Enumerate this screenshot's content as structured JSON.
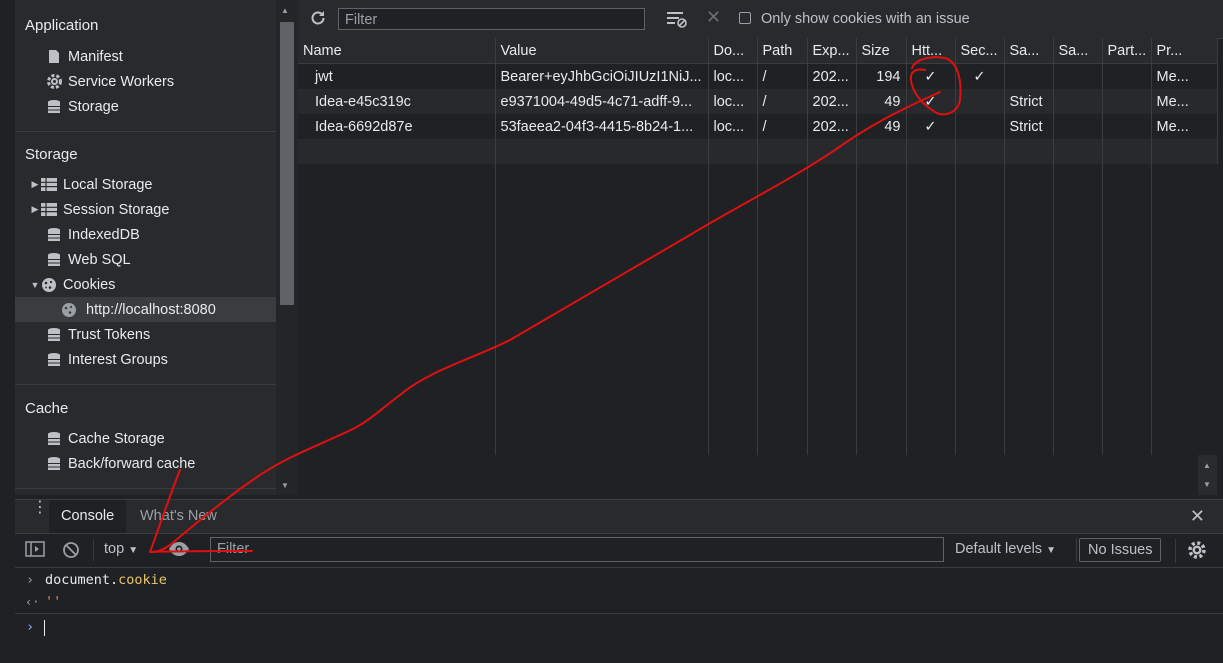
{
  "sidebar": {
    "application_title": "Application",
    "application_items": [
      "Manifest",
      "Service Workers",
      "Storage"
    ],
    "storage_title": "Storage",
    "storage_items": {
      "local_storage": "Local Storage",
      "session_storage": "Session Storage",
      "indexeddb": "IndexedDB",
      "web_sql": "Web SQL",
      "cookies": "Cookies",
      "cookies_origin": "http://localhost:8080",
      "trust_tokens": "Trust Tokens",
      "interest_groups": "Interest Groups"
    },
    "cache_title": "Cache",
    "cache_items": [
      "Cache Storage",
      "Back/forward cache"
    ]
  },
  "cookies_toolbar": {
    "filter_placeholder": "Filter",
    "only_issue_label": "Only show cookies with an issue",
    "only_issue_checked": false
  },
  "cookies_table": {
    "headers": [
      "Name",
      "Value",
      "Do...",
      "Path",
      "Exp...",
      "Size",
      "Htt...",
      "Sec...",
      "Sa...",
      "Sa...",
      "Part...",
      "Pr..."
    ],
    "rows": [
      [
        "jwt",
        "Bearer+eyJhbGciOiJIUzI1NiJ...",
        "loc...",
        "/",
        "202...",
        "194",
        "✓",
        "✓",
        "",
        "",
        "",
        "Me..."
      ],
      [
        "Idea-e45c319c",
        "e9371004-49d5-4c71-adff-9...",
        "loc...",
        "/",
        "202...",
        "49",
        "✓",
        "",
        "Strict",
        "",
        "",
        "Me..."
      ],
      [
        "Idea-6692d87e",
        "53faeea2-04f3-4415-8b24-1...",
        "loc...",
        "/",
        "202...",
        "49",
        "✓",
        "",
        "Strict",
        "",
        "",
        "Me..."
      ]
    ]
  },
  "drawer": {
    "tabs": [
      "Console",
      "What's New"
    ],
    "context": "top",
    "filter_placeholder": "Filter",
    "levels": "Default levels",
    "issues": "No Issues"
  },
  "console": {
    "input_prefix": "document.",
    "input_prop": "cookie",
    "output": "''"
  },
  "colors": {
    "annotation": "#e01010",
    "accent": "#8ab4f8",
    "property": "#e8c66a",
    "string": "#f28b54"
  }
}
